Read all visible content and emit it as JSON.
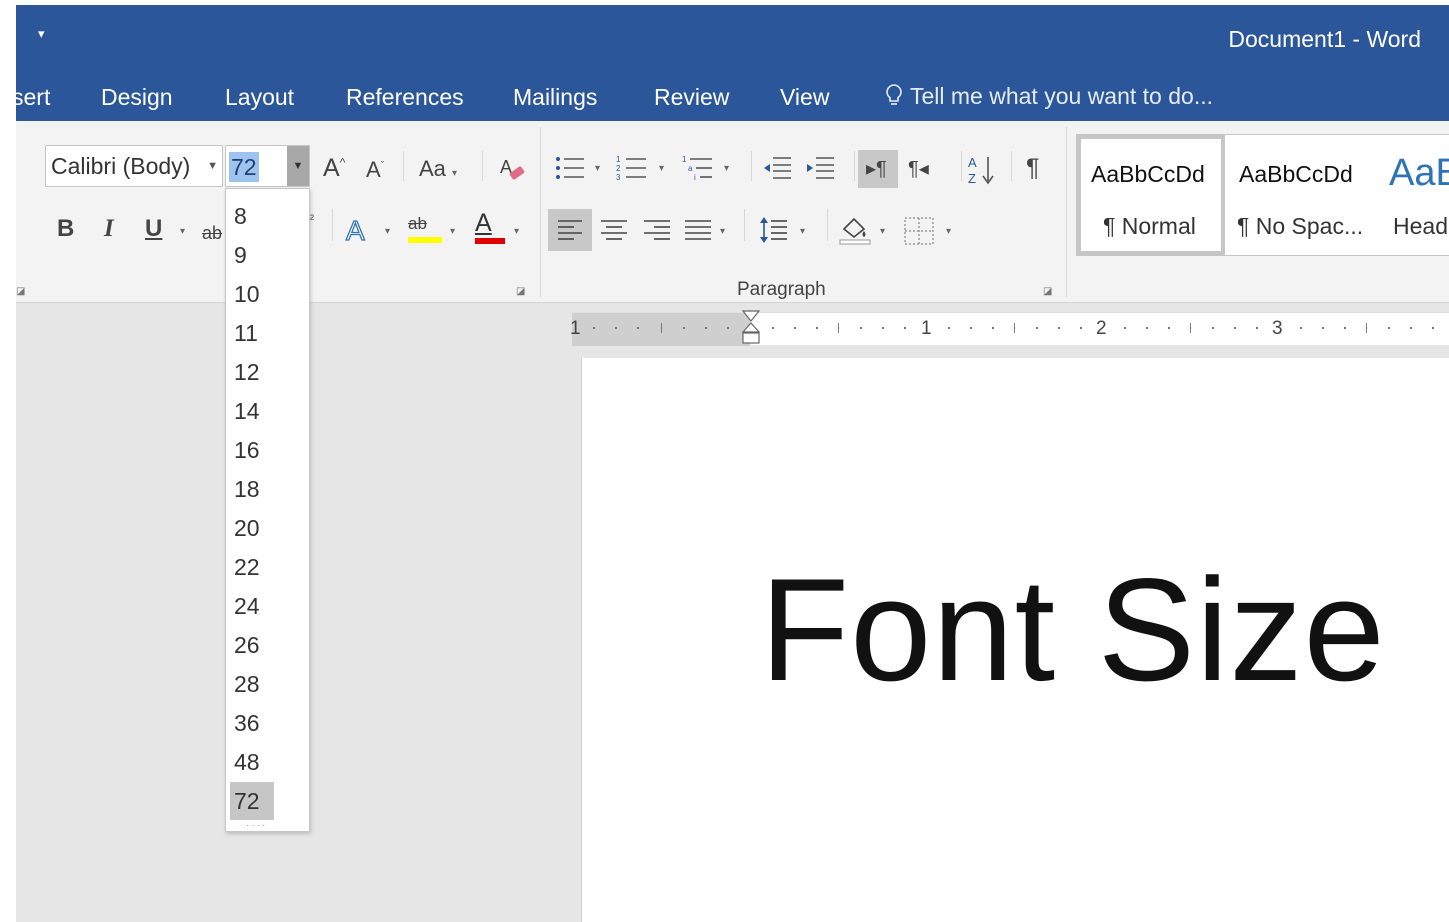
{
  "window": {
    "title": "Document1 - Word",
    "qat_glyph": "▾"
  },
  "tabs": [
    "sert",
    "Design",
    "Layout",
    "References",
    "Mailings",
    "Review",
    "View"
  ],
  "tell_me": {
    "placeholder": "Tell me what you want to do..."
  },
  "font": {
    "name": "Calibri (Body)",
    "size": "72",
    "size_options": [
      "8",
      "9",
      "10",
      "11",
      "12",
      "14",
      "16",
      "18",
      "20",
      "22",
      "24",
      "26",
      "28",
      "36",
      "48",
      "72"
    ],
    "selected_size": "72",
    "grow_label": "A",
    "shrink_label": "A",
    "change_case_label": "Aa",
    "bold_label": "B",
    "italic_label": "I",
    "underline_label": "U",
    "strikethrough_label": "ab",
    "superscript_label": "²",
    "text_effects_label": "A",
    "highlight_label": "ab",
    "font_color_label": "A",
    "highlight_color": "#ffff00",
    "font_color": "#e00000"
  },
  "paragraph": {
    "group_label": "Paragraph",
    "sort_label": "A Z",
    "pilcrow": "¶"
  },
  "styles": [
    {
      "preview": "AaBbCcDd",
      "name": "¶ Normal"
    },
    {
      "preview": "AaBbCcDd",
      "name": "¶ No Spac..."
    },
    {
      "preview": "AaB",
      "name": "Head",
      "color": "#2e74b5"
    }
  ],
  "ruler": {
    "labels": [
      "1",
      "1",
      "2",
      "3"
    ]
  },
  "document": {
    "text": "Font Size"
  },
  "colors": {
    "accent": "#2b579a",
    "selection": "#9dc3ef"
  }
}
